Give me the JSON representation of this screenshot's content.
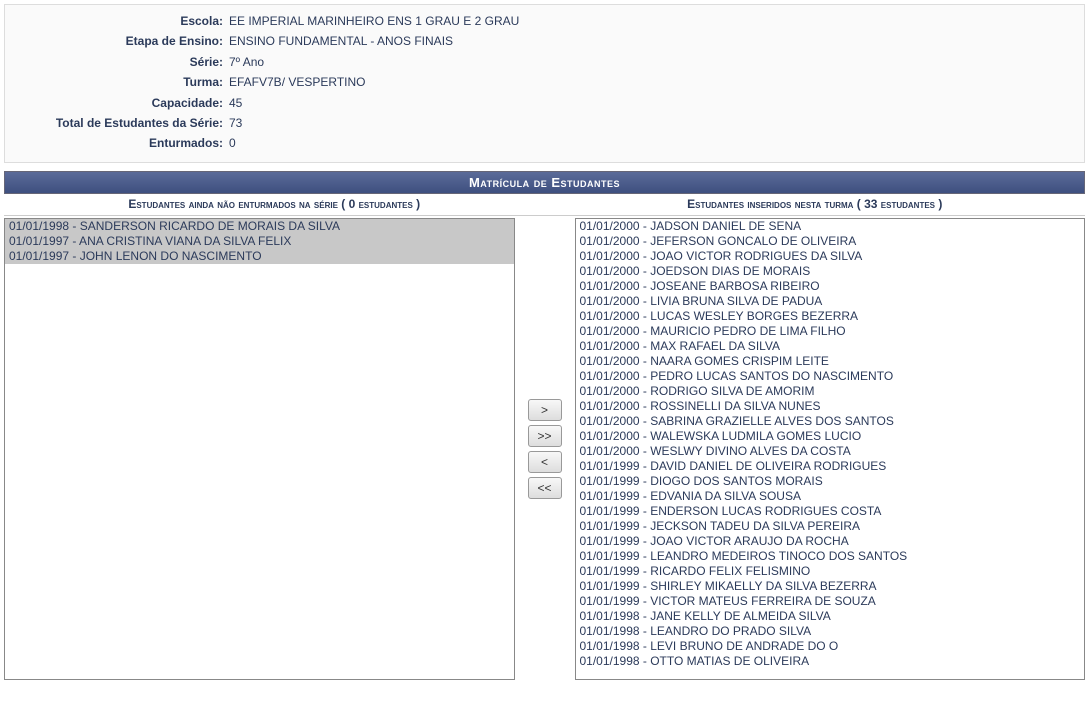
{
  "info": {
    "labels": {
      "escola": "Escola:",
      "etapa": "Etapa de Ensino:",
      "serie": "Série:",
      "turma": "Turma:",
      "capacidade": "Capacidade:",
      "total": "Total de Estudantes da Série:",
      "enturmados": "Enturmados:"
    },
    "values": {
      "escola": "EE IMPERIAL MARINHEIRO ENS 1 GRAU E 2 GRAU",
      "etapa": "ENSINO FUNDAMENTAL - ANOS FINAIS",
      "serie": "7º Ano",
      "turma": "EFAFV7B/ VESPERTINO",
      "capacidade": "45",
      "total": "73",
      "enturmados": "0"
    }
  },
  "section_title": "Matrícula de Estudantes",
  "headers": {
    "left": "Estudantes ainda não enturmados na série ( 0 estudantes )",
    "right": "Estudantes inseridos nesta turma ( 33 estudantes )"
  },
  "buttons": {
    "move_right": ">",
    "move_all_right": ">>",
    "move_left": "<",
    "move_all_left": "<<"
  },
  "left_list": [
    "01/01/1998 - SANDERSON RICARDO DE MORAIS DA SILVA",
    "01/01/1997 - ANA CRISTINA VIANA DA SILVA FELIX",
    "01/01/1997 - JOHN LENON DO NASCIMENTO"
  ],
  "left_selected_count": 3,
  "right_list": [
    "01/01/2000 - JADSON DANIEL DE SENA",
    "01/01/2000 - JEFERSON GONCALO DE OLIVEIRA",
    "01/01/2000 - JOAO VICTOR RODRIGUES DA SILVA",
    "01/01/2000 - JOEDSON DIAS DE MORAIS",
    "01/01/2000 - JOSEANE BARBOSA RIBEIRO",
    "01/01/2000 - LIVIA BRUNA SILVA DE PADUA",
    "01/01/2000 - LUCAS WESLEY BORGES BEZERRA",
    "01/01/2000 - MAURICIO PEDRO DE LIMA FILHO",
    "01/01/2000 - MAX RAFAEL DA SILVA",
    "01/01/2000 - NAARA GOMES CRISPIM LEITE",
    "01/01/2000 - PEDRO LUCAS SANTOS DO NASCIMENTO",
    "01/01/2000 - RODRIGO SILVA DE AMORIM",
    "01/01/2000 - ROSSINELLI DA SILVA NUNES",
    "01/01/2000 - SABRINA GRAZIELLE ALVES DOS SANTOS",
    "01/01/2000 - WALEWSKA LUDMILA GOMES LUCIO",
    "01/01/2000 - WESLWY DIVINO ALVES DA COSTA",
    "01/01/1999 - DAVID DANIEL DE OLIVEIRA RODRIGUES",
    "01/01/1999 - DIOGO DOS SANTOS MORAIS",
    "01/01/1999 - EDVANIA DA SILVA SOUSA",
    "01/01/1999 - ENDERSON LUCAS RODRIGUES COSTA",
    "01/01/1999 - JECKSON TADEU DA SILVA PEREIRA",
    "01/01/1999 - JOAO VICTOR ARAUJO DA ROCHA",
    "01/01/1999 - LEANDRO MEDEIROS TINOCO DOS SANTOS",
    "01/01/1999 - RICARDO FELIX FELISMINO",
    "01/01/1999 - SHIRLEY MIKAELLY DA SILVA BEZERRA",
    "01/01/1999 - VICTOR MATEUS FERREIRA DE SOUZA",
    "01/01/1998 - JANE KELLY DE ALMEIDA SILVA",
    "01/01/1998 - LEANDRO DO PRADO SILVA",
    "01/01/1998 - LEVI BRUNO DE ANDRADE DO O",
    "01/01/1998 - OTTO MATIAS DE OLIVEIRA"
  ]
}
